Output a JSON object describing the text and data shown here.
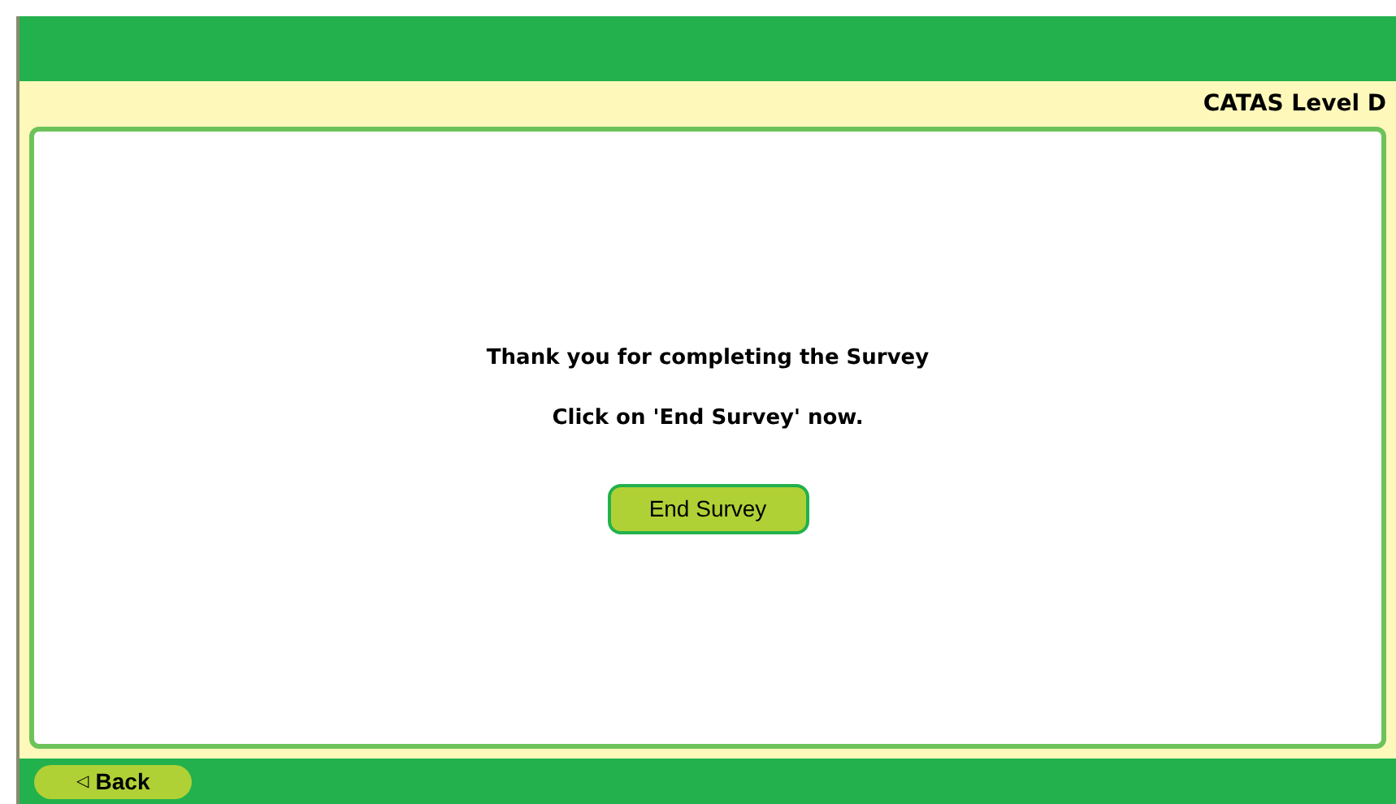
{
  "header": {
    "level_label": "CATAS Level D"
  },
  "message": {
    "lines": [
      "Thank you for completing the Survey",
      "Click on 'End Survey' now."
    ]
  },
  "end_button": {
    "label": "End Survey"
  },
  "footer": {
    "back_button": {
      "icon": "◁",
      "label": "Back"
    }
  }
}
